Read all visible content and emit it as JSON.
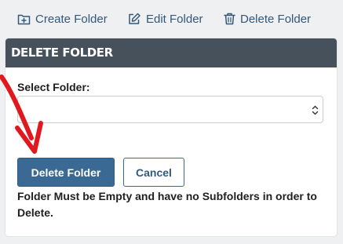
{
  "toolbar": {
    "create_label": "Create Folder",
    "edit_label": "Edit Folder",
    "delete_label": "Delete Folder"
  },
  "panel": {
    "title": "DELETE FOLDER",
    "select_label": "Select Folder:",
    "select_value": "",
    "delete_button": "Delete Folder",
    "cancel_button": "Cancel",
    "note": "Folder Must be Empty and have no Subfolders in order to Delete."
  },
  "colors": {
    "header_bg": "#46515b",
    "primary": "#3a6a93",
    "toolbar_text": "#34577a",
    "annotation_arrow": "#e0191f"
  },
  "icons": {
    "create": "folder-plus-icon",
    "edit": "edit-icon",
    "delete": "trash-icon",
    "select": "chevron-updown-icon"
  }
}
